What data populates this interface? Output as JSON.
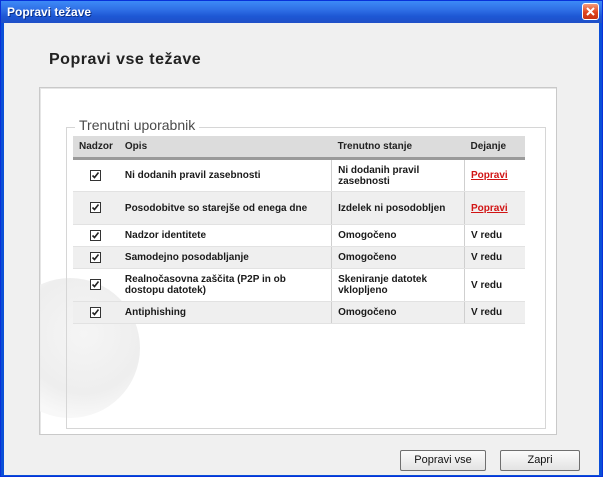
{
  "window": {
    "title": "Popravi težave"
  },
  "heading": "Popravi vse težave",
  "group": {
    "legend": "Trenutni uporabnik"
  },
  "table": {
    "headers": {
      "check": "Nadzor",
      "desc": "Opis",
      "status": "Trenutno stanje",
      "action": "Dejanje"
    },
    "rows": [
      {
        "desc": "Ni dodanih pravil zasebnosti",
        "status": "Ni dodanih pravil zasebnosti",
        "action": "Popravi"
      },
      {
        "desc": "Posodobitve so starejše od enega dne",
        "status": "Izdelek ni posodobljen",
        "action": "Popravi"
      },
      {
        "desc": "Nadzor identitete",
        "status": "Omogočeno",
        "action": "V redu"
      },
      {
        "desc": "Samodejno posodabljanje",
        "status": "Omogočeno",
        "action": "V redu"
      },
      {
        "desc": "Realnočasovna zaščita (P2P in ob dostopu datotek)",
        "status": "Skeniranje datotek vklopljeno",
        "action": "V redu"
      },
      {
        "desc": "Antiphishing",
        "status": "Omogočeno",
        "action": "V redu"
      }
    ]
  },
  "buttons": {
    "fix_all": "Popravi vse",
    "close": "Zapri"
  },
  "icons": {
    "close": "close-icon",
    "checkbox": "checkmark-icon"
  },
  "colors": {
    "titlebar": "#2f6fe6",
    "link": "#d11414",
    "close": "#e0441e"
  }
}
